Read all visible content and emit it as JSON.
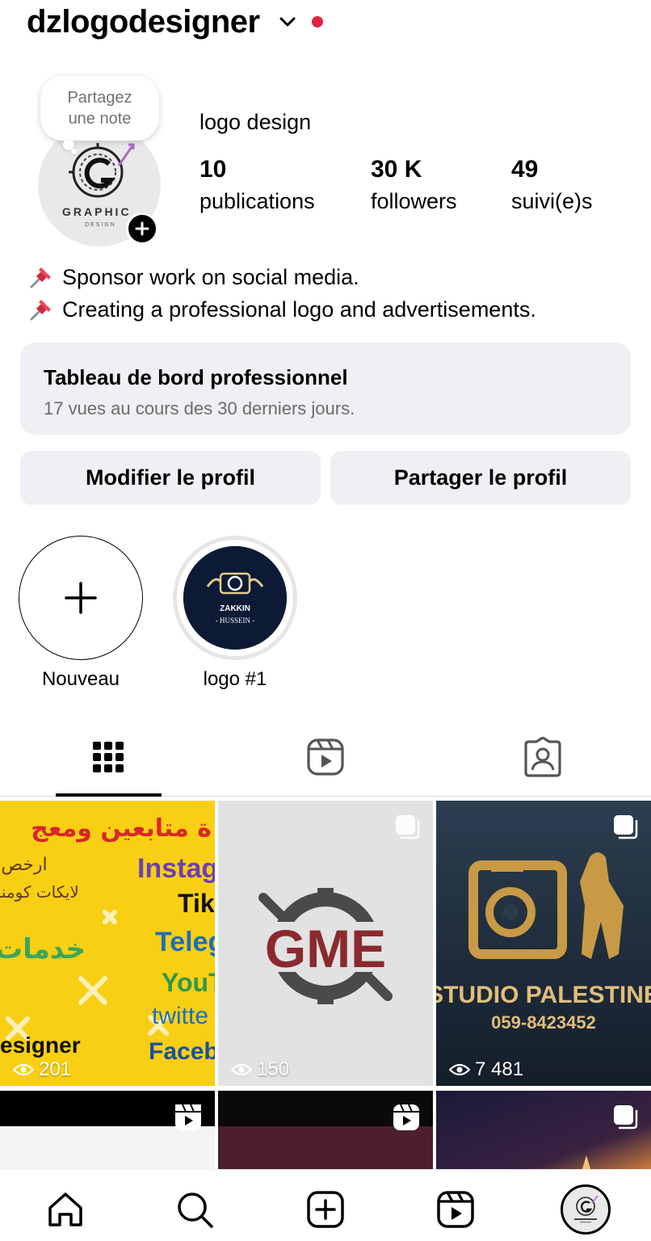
{
  "header": {
    "username": "dzlogodesigner"
  },
  "note": {
    "text_line1": "Partagez",
    "text_line2": "une note"
  },
  "profile": {
    "display_name": "logo design",
    "avatar_text": "GRAPHIC",
    "avatar_subtext": "DESIGN",
    "stats": [
      {
        "value": "10",
        "label": "publications"
      },
      {
        "value": "30 K",
        "label": "followers"
      },
      {
        "value": "49",
        "label": "suivi(e)s"
      }
    ],
    "bio": [
      "Sponsor work on social media.",
      "Creating a professional logo and advertisements."
    ]
  },
  "dashboard": {
    "title": "Tableau de bord professionnel",
    "subtitle": "17 vues au cours des 30 derniers jours."
  },
  "buttons": {
    "edit": "Modifier le profil",
    "share": "Partager le profil"
  },
  "highlights": [
    {
      "label": "Nouveau",
      "icon": "plus-icon"
    },
    {
      "label": "logo #1",
      "line1": "ZAKKIN",
      "line2": "- HUSSEIN -"
    }
  ],
  "tabs": [
    "grid-icon",
    "reels-icon",
    "tagged-icon"
  ],
  "posts": [
    {
      "views": "201",
      "arabic_top": "ة متابعين ومعج",
      "arabic_1": "ارخص",
      "arabic_2": "لايكات كومنت",
      "arabic_3": "خدمات",
      "platforms": [
        "Instag",
        "Tikt",
        "Teleg",
        "YouT",
        "twitte",
        "Facebo"
      ],
      "word": "esigner"
    },
    {
      "views": "150",
      "brand": "GME"
    },
    {
      "views": "7 481",
      "brand": "STUDIO PALESTINE",
      "phone": "059-8423452"
    }
  ],
  "colors": {
    "accent_red": "#e0243b",
    "button_bg": "#eff0f3",
    "gme_red": "#8b2a2e"
  },
  "bottom_nav": [
    "home-icon",
    "search-icon",
    "create-icon",
    "reels-icon",
    "profile-avatar"
  ]
}
